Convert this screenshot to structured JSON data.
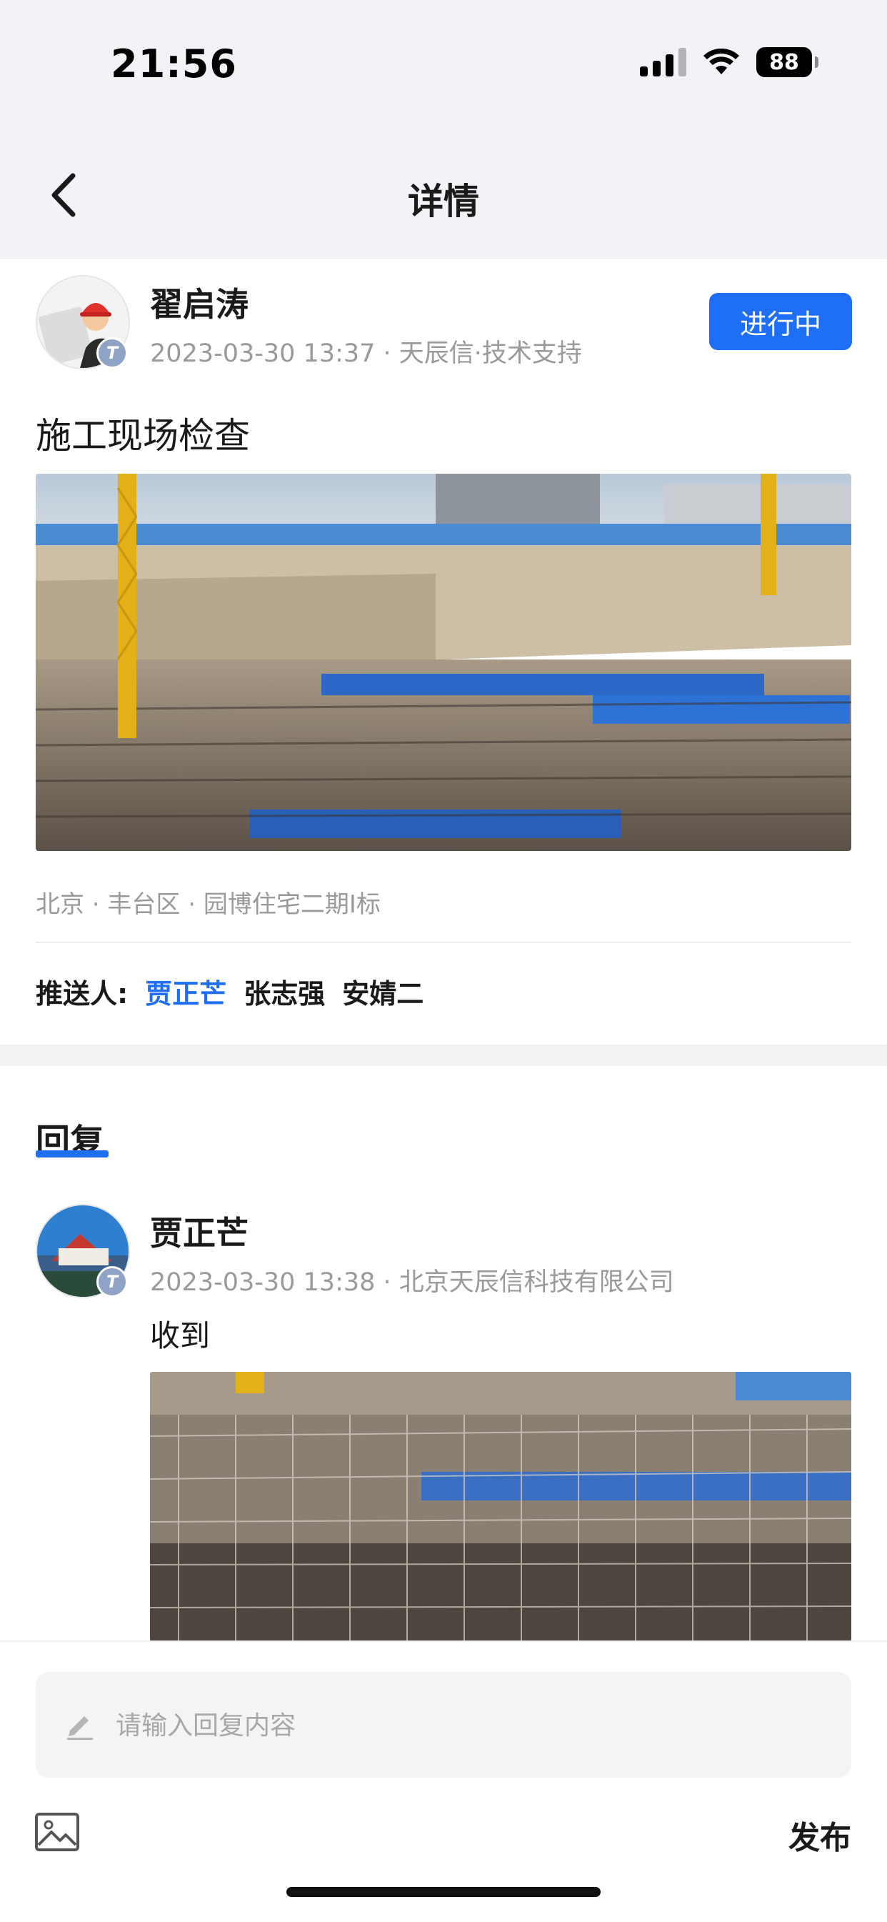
{
  "status_bar": {
    "time": "21:56",
    "battery": "88"
  },
  "nav": {
    "title": "详情"
  },
  "post": {
    "author": "翟启涛",
    "avatar_badge": "T",
    "meta": "2023-03-30 13:37 · 天辰信·技术支持",
    "status": "进行中",
    "title": "施工现场检查",
    "location": "北京 · 丰台区 · 园博住宅二期I标",
    "recipients_label": "推送人:",
    "recipients": [
      "贾正芒",
      "张志强",
      "安婧二"
    ]
  },
  "replies_section": {
    "heading": "回复"
  },
  "reply": {
    "author": "贾正芒",
    "avatar_badge": "T",
    "meta": "2023-03-30 13:38 · 北京天辰信科技有限公司",
    "text": "收到"
  },
  "composer": {
    "placeholder": "请输入回复内容",
    "publish_label": "发布"
  },
  "colors": {
    "accent": "#1e6ff5",
    "muted_text": "#9a9a9a",
    "nav_background": "#f2f2f7"
  }
}
